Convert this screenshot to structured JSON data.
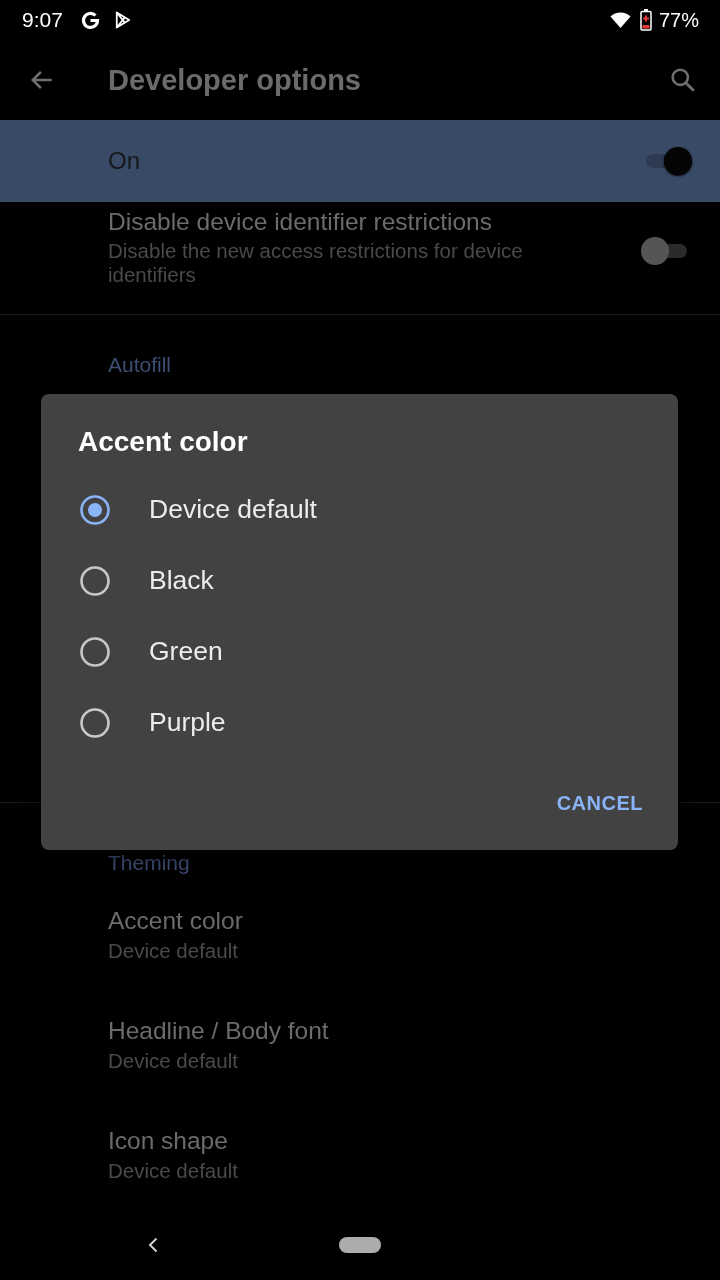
{
  "status_bar": {
    "time": "9:07",
    "battery": "77%"
  },
  "app_bar": {
    "title": "Developer options"
  },
  "master_switch": {
    "label": "On",
    "on": true
  },
  "settings_above": [
    {
      "kind": "switch",
      "title": "Disable device identifier restrictions",
      "summary": "Disable the new access restrictions for device identifiers",
      "on": false
    },
    {
      "kind": "category",
      "title": "Autofill"
    }
  ],
  "dialog": {
    "title": "Accent color",
    "options": [
      {
        "label": "Device default",
        "selected": true
      },
      {
        "label": "Black",
        "selected": false
      },
      {
        "label": "Green",
        "selected": false
      },
      {
        "label": "Purple",
        "selected": false
      }
    ],
    "buttons": [
      {
        "label": "CANCEL"
      }
    ]
  },
  "settings_below": [
    {
      "kind": "category",
      "title": "Theming"
    },
    {
      "kind": "item",
      "title": "Accent color",
      "summary": "Device default"
    },
    {
      "kind": "item",
      "title": "Headline / Body font",
      "summary": "Device default"
    },
    {
      "kind": "item",
      "title": "Icon shape",
      "summary": "Device default"
    }
  ]
}
